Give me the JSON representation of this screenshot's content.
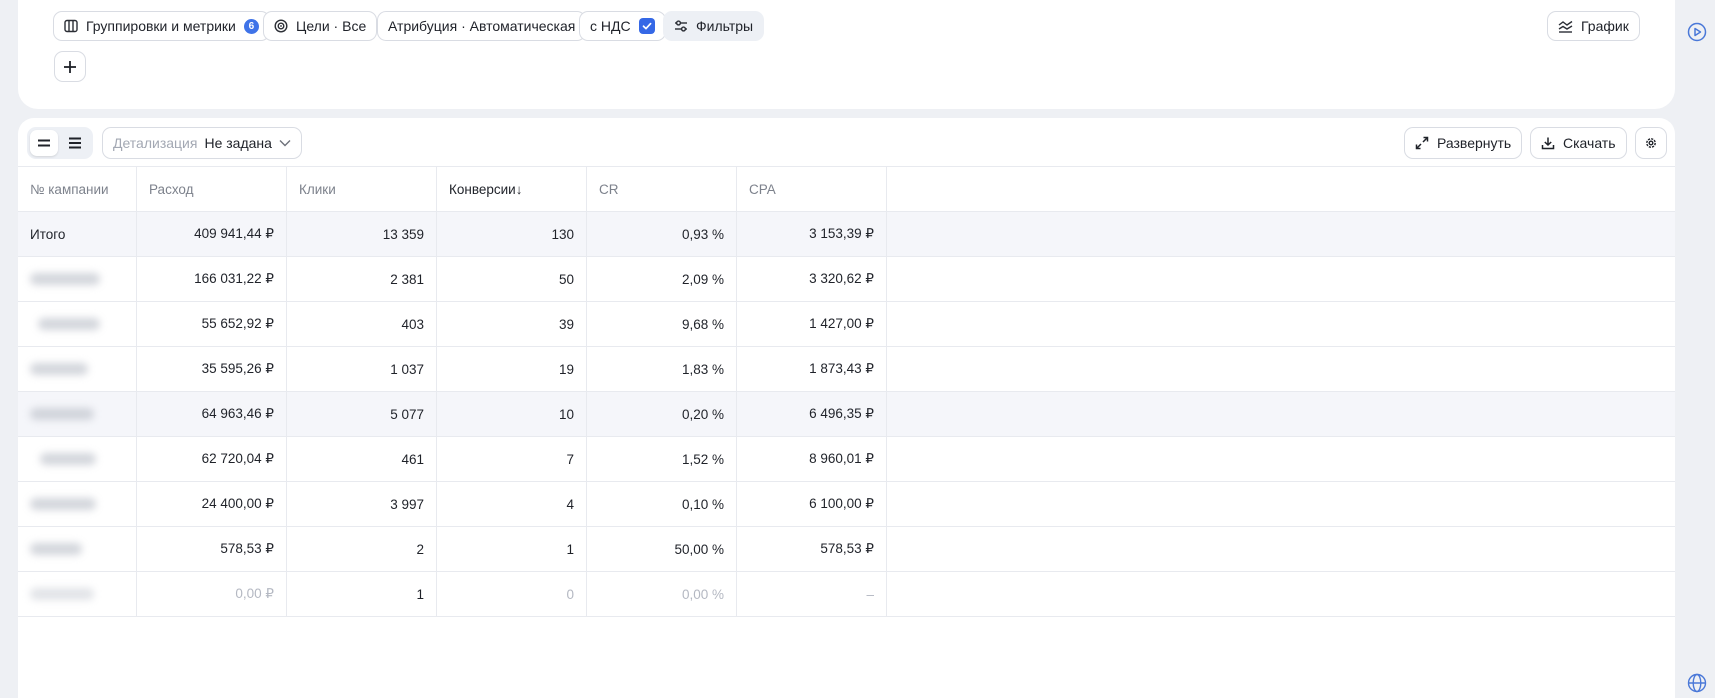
{
  "toolbar": {
    "groupings_label": "Группировки и метрики",
    "groupings_count": "6",
    "goals_label": "Цели · Все",
    "attribution_label": "Атрибуция · Автоматическая",
    "vat_label": "с НДС",
    "vat_checked": true,
    "filters_label": "Фильтры",
    "chart_label": "График"
  },
  "table_toolbar": {
    "detail_label": "Детализация",
    "detail_value": "Не задана",
    "expand_label": "Развернуть",
    "download_label": "Скачать"
  },
  "table": {
    "columns": [
      "№ кампании",
      "Расход",
      "Клики",
      "Конверсии↓",
      "CR",
      "CPA"
    ],
    "sorted_column": "Конверсии↓",
    "total": {
      "name": "Итого",
      "spend": "409 941,44 ₽",
      "clicks": "13 359",
      "conversions": "130",
      "cr": "0,93 %",
      "cpa": "3 153,39 ₽"
    },
    "rows": [
      {
        "spend": "166 031,22 ₽",
        "clicks": "2 381",
        "conversions": "50",
        "cr": "2,09 %",
        "cpa": "3 320,62 ₽"
      },
      {
        "spend": "55 652,92 ₽",
        "clicks": "403",
        "conversions": "39",
        "cr": "9,68 %",
        "cpa": "1 427,00 ₽"
      },
      {
        "spend": "35 595,26 ₽",
        "clicks": "1 037",
        "conversions": "19",
        "cr": "1,83 %",
        "cpa": "1 873,43 ₽"
      },
      {
        "spend": "64 963,46 ₽",
        "clicks": "5 077",
        "conversions": "10",
        "cr": "0,20 %",
        "cpa": "6 496,35 ₽"
      },
      {
        "spend": "62 720,04 ₽",
        "clicks": "461",
        "conversions": "7",
        "cr": "1,52 %",
        "cpa": "8 960,01 ₽"
      },
      {
        "spend": "24 400,00 ₽",
        "clicks": "3 997",
        "conversions": "4",
        "cr": "0,10 %",
        "cpa": "6 100,00 ₽"
      },
      {
        "spend": "578,53 ₽",
        "clicks": "2",
        "conversions": "1",
        "cr": "50,00 %",
        "cpa": "578,53 ₽"
      },
      {
        "spend": "0,00 ₽",
        "clicks": "1",
        "conversions": "0",
        "cr": "0,00 %",
        "cpa": "–"
      }
    ]
  },
  "colors": {
    "accent": "#3568e6",
    "badge": "#3f73e8",
    "row_highlight": "#f5f6fa",
    "page_bg": "#eef0f4"
  },
  "icons": [
    "columns-icon",
    "target-icon",
    "sliders-icon",
    "chart-lines-icon",
    "plus-icon",
    "compact-rows-icon",
    "list-rows-icon",
    "chevron-down-icon",
    "expand-icon",
    "download-icon",
    "gear-icon",
    "play-circle-icon",
    "globe-icon"
  ]
}
